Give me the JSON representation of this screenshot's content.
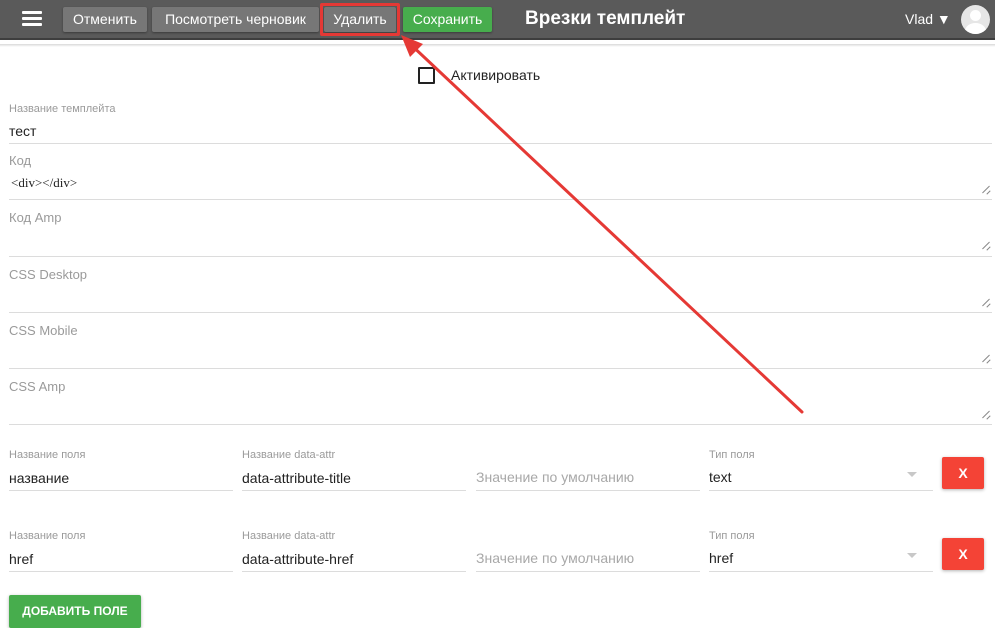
{
  "toolbar": {
    "cancel_label": "Отменить",
    "preview_draft_label": "Посмотреть черновик",
    "delete_label": "Удалить",
    "save_label": "Сохранить",
    "title": "Врезки темплейт",
    "user_name": "Vlad ▼",
    "colors": {
      "bar": "#5a5a5a",
      "button": "#777777",
      "save": "#47ad4d"
    }
  },
  "activate": {
    "label": "Активировать",
    "checked": false
  },
  "form": {
    "template_name": {
      "label": "Название темплейта",
      "value": "тест"
    },
    "code": {
      "label": "Код",
      "value": "<div></div>"
    },
    "code_amp": {
      "label": "Код Amp",
      "value": ""
    },
    "css_desktop": {
      "label": "CSS Desktop",
      "value": ""
    },
    "css_mobile": {
      "label": "CSS Mobile",
      "value": ""
    },
    "css_amp": {
      "label": "CSS Amp",
      "value": ""
    }
  },
  "field_rows": [
    {
      "name_label": "Название поля",
      "name_value": "название",
      "attr_label": "Название data-attr",
      "attr_value": "data-attribute-title",
      "default_placeholder": "Значение по умолчанию",
      "type_label": "Тип поля",
      "type_value": "text",
      "remove_label": "X"
    },
    {
      "name_label": "Название поля",
      "name_value": "href",
      "attr_label": "Название data-attr",
      "attr_value": "data-attribute-href",
      "default_placeholder": "Значение по умолчанию",
      "type_label": "Тип поля",
      "type_value": "href",
      "remove_label": "X"
    }
  ],
  "add_field_label": "ДОБАВИТЬ ПОЛЕ",
  "annotation": {
    "color": "#e53935",
    "target": "delete-button"
  }
}
